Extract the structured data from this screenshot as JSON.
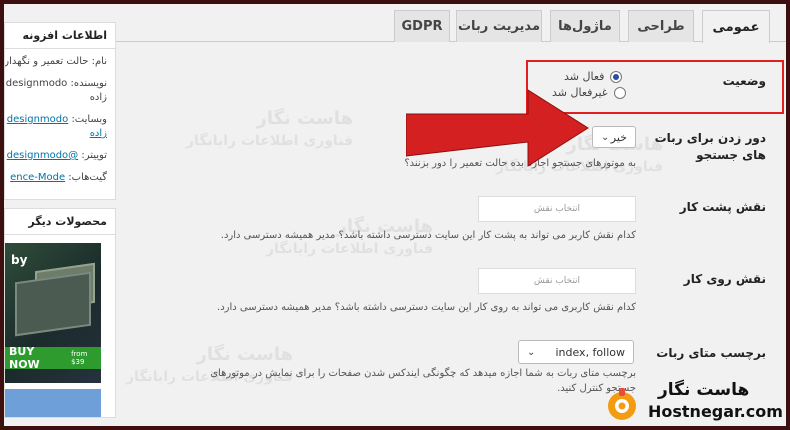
{
  "tabs": [
    {
      "label": "عمومی",
      "active": true
    },
    {
      "label": "طراحی",
      "active": false
    },
    {
      "label": "ماژول‌ها",
      "active": false
    },
    {
      "label": "مدیریت ربات",
      "active": false
    },
    {
      "label": "GDPR",
      "active": false
    }
  ],
  "sidebar": {
    "info_title": "اطلاعات افزونه",
    "info_lines": [
      {
        "prefix": "نام:",
        "text": "حالت تعمیر و نگهداری"
      },
      {
        "prefix": "نویسنده:",
        "text": "designmodo"
      },
      {
        "prefix": "",
        "text": "زاده"
      },
      {
        "prefix": "وبسایت:",
        "text": "designmodo"
      },
      {
        "prefix": "",
        "text": "زاده"
      },
      {
        "prefix": "توییتر:",
        "text": "@designmodo"
      },
      {
        "prefix": "گیت‌هاب:",
        "text": "ence-Mode"
      }
    ],
    "other_title": "محصولات دیگر",
    "promo_by": "by",
    "buy_label": "BUY NOW",
    "buy_price": "from $39"
  },
  "status": {
    "label": "وضعیت",
    "options": [
      {
        "label": "فعال شد",
        "checked": true
      },
      {
        "label": "غیرفعال شد",
        "checked": false
      }
    ]
  },
  "bypass": {
    "label": "دور زدن برای ربات های جستجو",
    "value": "خیر",
    "desc": "به موتورهای جستجو اجازه بده حالت تعمیر را دور بزنند؟"
  },
  "backend_role": {
    "label": "نقش پشت کار",
    "placeholder": "انتخاب نقش",
    "desc": "کدام نقش کاربر می تواند به پشت کار این سایت دسترسی داشته باشد؟ مدیر همیشه دسترسی دارد."
  },
  "frontend_role": {
    "label": "نقش روی کار",
    "placeholder": "انتخاب نقش",
    "desc": "کدام نقش کاربری می تواند به روی کار این سایت دسترسی داشته باشد؟ مدیر همیشه دسترسی دارد."
  },
  "robots_meta": {
    "label": "برچسب متای ربات",
    "value": "index, follow",
    "desc_line1": "برچسب متای ربات به شما اجازه میدهد که چگونگی ایندکس شدن صفحات را برای نمایش در موتورهای",
    "desc_line2": "جستجو کنترل کنید."
  },
  "watermark": {
    "title": "هاست نگار",
    "subtitle": "فناوری اطلاعات رایانگار"
  },
  "logo": {
    "fa": "هاست نگار",
    "en": "Hostnegar.com"
  },
  "colors": {
    "highlight": "#e02020",
    "arrow": "#d42020",
    "link": "#0073aa",
    "buy": "#2e9b2e"
  }
}
